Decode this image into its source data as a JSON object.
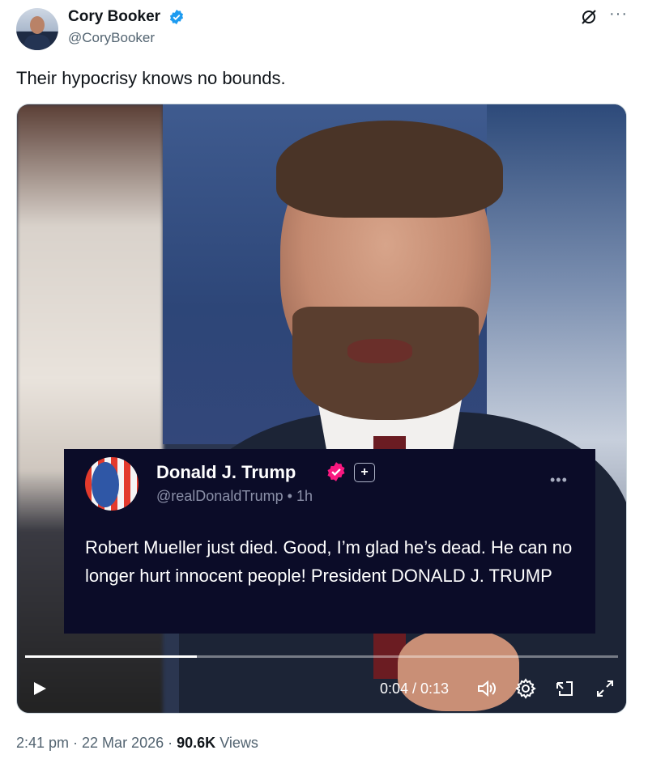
{
  "author": {
    "name": "Cory Booker",
    "handle": "@CoryBooker"
  },
  "tweet": {
    "text": "Their hypocrisy knows no bounds."
  },
  "embedded_post": {
    "name": "Donald J. Trump",
    "handle_time": "@realDonaldTrump • 1h",
    "body": "Robert Mueller just died. Good, I’m glad he’s dead. He can no longer hurt innocent people! President DONALD J. TRUMP"
  },
  "video": {
    "time": "0:04 / 0:13",
    "progress_fraction": 0.29
  },
  "footer": {
    "timestamp": "2:41 pm · 22 Mar 2026 ·",
    "views_count": "90.6K",
    "views_label": "Views"
  },
  "colors": {
    "verified_blue": "#1d9bf0",
    "badge_pink": "#f91880"
  }
}
